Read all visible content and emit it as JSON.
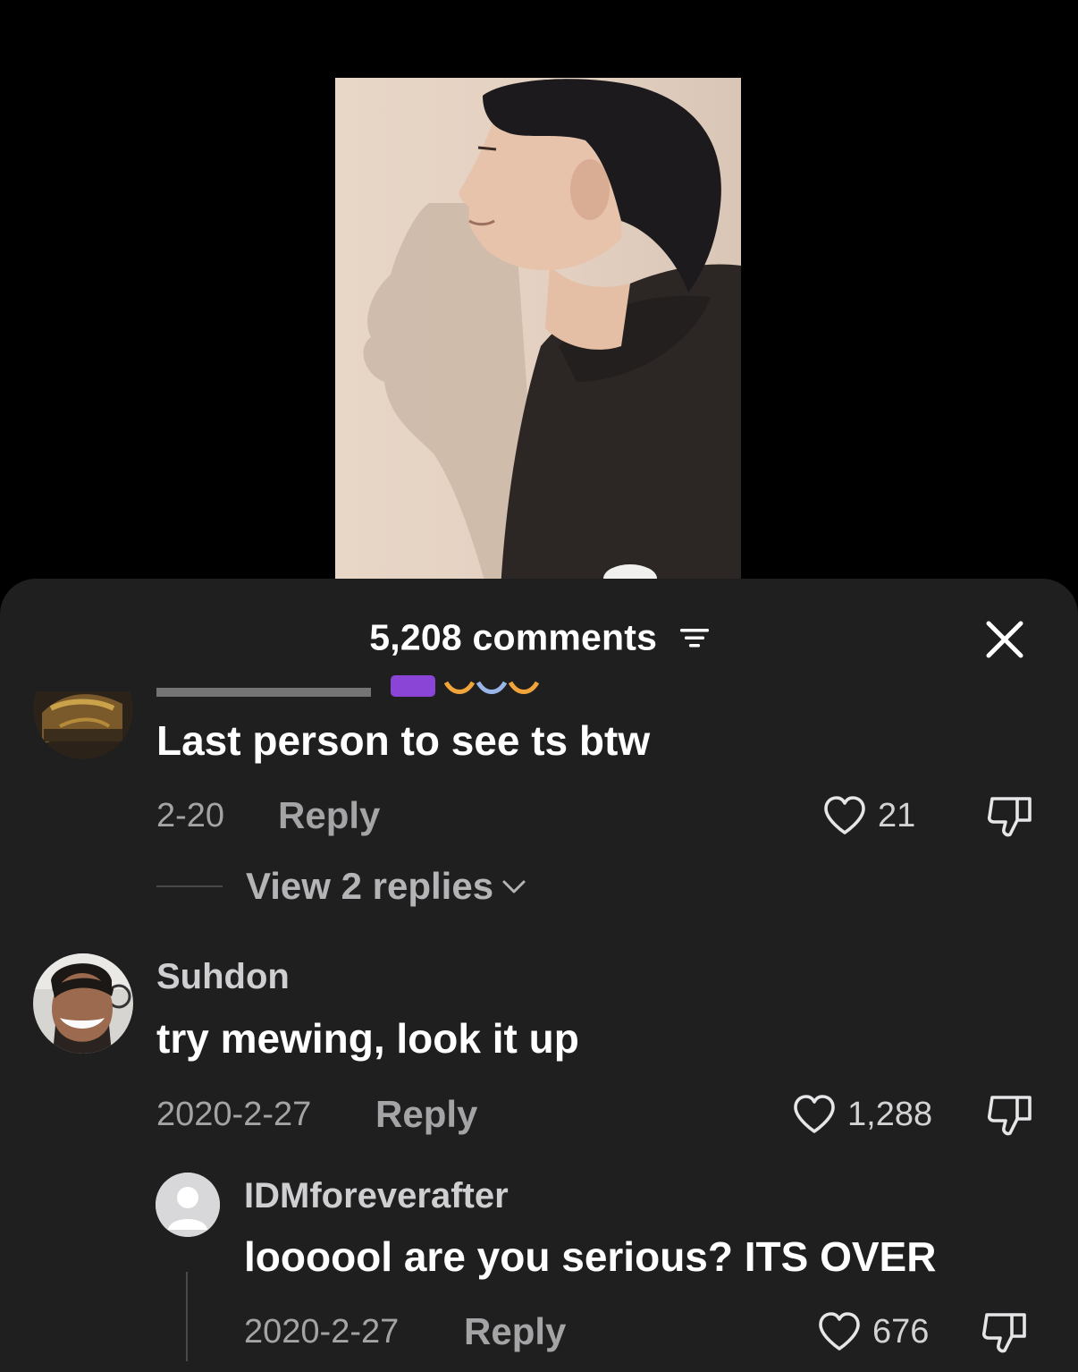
{
  "header": {
    "comments_count": "5,208 comments"
  },
  "icons": {
    "filter": "filter-lines-icon",
    "close": "close-x-icon",
    "like": "heart-outline-icon",
    "dislike": "thumbs-down-icon",
    "chevron": "chevron-down-icon"
  },
  "comments": [
    {
      "username": "",
      "text": "Last person to see ts btw",
      "date": "2-20",
      "reply_label": "Reply",
      "likes": "21",
      "view_replies": "View 2 replies"
    },
    {
      "username": "Suhdon",
      "text": "try mewing, look it up",
      "date": "2020-2-27",
      "reply_label": "Reply",
      "likes": "1,288",
      "replies": [
        {
          "username": "IDMforeverafter",
          "text": "loooool are you serious? ITS OVER",
          "date": "2020-2-27",
          "reply_label": "Reply",
          "likes": "676"
        }
      ]
    }
  ],
  "colors": {
    "sheet_background": "#1f1f20",
    "muted_text": "#a4a4a6",
    "badge_purple": "#8b45d6",
    "emoji_orange": "#f0a43a"
  }
}
